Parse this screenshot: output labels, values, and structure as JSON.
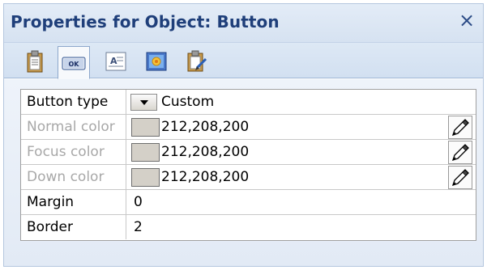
{
  "window": {
    "title": "Properties for Object: Button",
    "close_glyph": "×"
  },
  "tabs": [
    {
      "icon": "clipboard-icon",
      "active": false
    },
    {
      "icon": "button-ok-icon",
      "active": true,
      "icon_text": "OK"
    },
    {
      "icon": "text-field-icon",
      "active": false
    },
    {
      "icon": "image-icon",
      "active": false
    },
    {
      "icon": "clipboard-edit-icon",
      "active": false
    }
  ],
  "properties": [
    {
      "label": "Button type",
      "value": "Custom",
      "enabled": true,
      "kind": "dropdown"
    },
    {
      "label": "Normal color",
      "value": "212,208,200",
      "enabled": false,
      "kind": "color",
      "swatch": "#d4d0c8"
    },
    {
      "label": "Focus color",
      "value": "212,208,200",
      "enabled": false,
      "kind": "color",
      "swatch": "#d4d0c8"
    },
    {
      "label": "Down color",
      "value": "212,208,200",
      "enabled": false,
      "kind": "color",
      "swatch": "#d4d0c8"
    },
    {
      "label": "Margin",
      "value": "0",
      "enabled": true,
      "kind": "text"
    },
    {
      "label": "Border",
      "value": "2",
      "enabled": true,
      "kind": "text"
    }
  ],
  "colors": {
    "title_text": "#1f3f7a",
    "disabled_label": "#a8a8a8",
    "accent_border": "#9fb6d6"
  }
}
